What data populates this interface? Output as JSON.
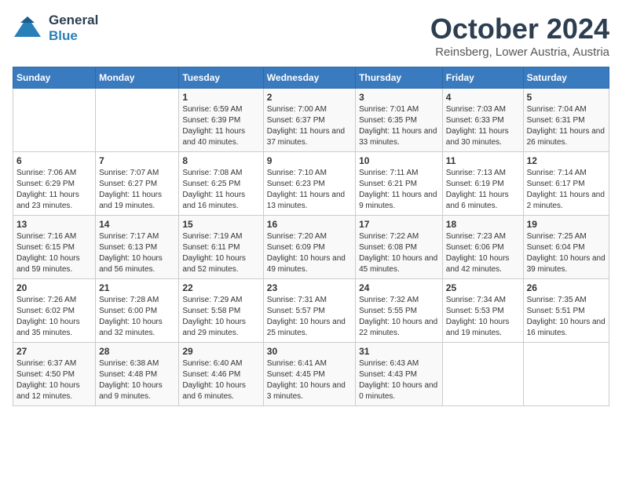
{
  "logo": {
    "line1": "General",
    "line2": "Blue"
  },
  "title": "October 2024",
  "subtitle": "Reinsberg, Lower Austria, Austria",
  "days_of_week": [
    "Sunday",
    "Monday",
    "Tuesday",
    "Wednesday",
    "Thursday",
    "Friday",
    "Saturday"
  ],
  "weeks": [
    [
      {
        "day": "",
        "detail": ""
      },
      {
        "day": "",
        "detail": ""
      },
      {
        "day": "1",
        "detail": "Sunrise: 6:59 AM\nSunset: 6:39 PM\nDaylight: 11 hours and 40 minutes."
      },
      {
        "day": "2",
        "detail": "Sunrise: 7:00 AM\nSunset: 6:37 PM\nDaylight: 11 hours and 37 minutes."
      },
      {
        "day": "3",
        "detail": "Sunrise: 7:01 AM\nSunset: 6:35 PM\nDaylight: 11 hours and 33 minutes."
      },
      {
        "day": "4",
        "detail": "Sunrise: 7:03 AM\nSunset: 6:33 PM\nDaylight: 11 hours and 30 minutes."
      },
      {
        "day": "5",
        "detail": "Sunrise: 7:04 AM\nSunset: 6:31 PM\nDaylight: 11 hours and 26 minutes."
      }
    ],
    [
      {
        "day": "6",
        "detail": "Sunrise: 7:06 AM\nSunset: 6:29 PM\nDaylight: 11 hours and 23 minutes."
      },
      {
        "day": "7",
        "detail": "Sunrise: 7:07 AM\nSunset: 6:27 PM\nDaylight: 11 hours and 19 minutes."
      },
      {
        "day": "8",
        "detail": "Sunrise: 7:08 AM\nSunset: 6:25 PM\nDaylight: 11 hours and 16 minutes."
      },
      {
        "day": "9",
        "detail": "Sunrise: 7:10 AM\nSunset: 6:23 PM\nDaylight: 11 hours and 13 minutes."
      },
      {
        "day": "10",
        "detail": "Sunrise: 7:11 AM\nSunset: 6:21 PM\nDaylight: 11 hours and 9 minutes."
      },
      {
        "day": "11",
        "detail": "Sunrise: 7:13 AM\nSunset: 6:19 PM\nDaylight: 11 hours and 6 minutes."
      },
      {
        "day": "12",
        "detail": "Sunrise: 7:14 AM\nSunset: 6:17 PM\nDaylight: 11 hours and 2 minutes."
      }
    ],
    [
      {
        "day": "13",
        "detail": "Sunrise: 7:16 AM\nSunset: 6:15 PM\nDaylight: 10 hours and 59 minutes."
      },
      {
        "day": "14",
        "detail": "Sunrise: 7:17 AM\nSunset: 6:13 PM\nDaylight: 10 hours and 56 minutes."
      },
      {
        "day": "15",
        "detail": "Sunrise: 7:19 AM\nSunset: 6:11 PM\nDaylight: 10 hours and 52 minutes."
      },
      {
        "day": "16",
        "detail": "Sunrise: 7:20 AM\nSunset: 6:09 PM\nDaylight: 10 hours and 49 minutes."
      },
      {
        "day": "17",
        "detail": "Sunrise: 7:22 AM\nSunset: 6:08 PM\nDaylight: 10 hours and 45 minutes."
      },
      {
        "day": "18",
        "detail": "Sunrise: 7:23 AM\nSunset: 6:06 PM\nDaylight: 10 hours and 42 minutes."
      },
      {
        "day": "19",
        "detail": "Sunrise: 7:25 AM\nSunset: 6:04 PM\nDaylight: 10 hours and 39 minutes."
      }
    ],
    [
      {
        "day": "20",
        "detail": "Sunrise: 7:26 AM\nSunset: 6:02 PM\nDaylight: 10 hours and 35 minutes."
      },
      {
        "day": "21",
        "detail": "Sunrise: 7:28 AM\nSunset: 6:00 PM\nDaylight: 10 hours and 32 minutes."
      },
      {
        "day": "22",
        "detail": "Sunrise: 7:29 AM\nSunset: 5:58 PM\nDaylight: 10 hours and 29 minutes."
      },
      {
        "day": "23",
        "detail": "Sunrise: 7:31 AM\nSunset: 5:57 PM\nDaylight: 10 hours and 25 minutes."
      },
      {
        "day": "24",
        "detail": "Sunrise: 7:32 AM\nSunset: 5:55 PM\nDaylight: 10 hours and 22 minutes."
      },
      {
        "day": "25",
        "detail": "Sunrise: 7:34 AM\nSunset: 5:53 PM\nDaylight: 10 hours and 19 minutes."
      },
      {
        "day": "26",
        "detail": "Sunrise: 7:35 AM\nSunset: 5:51 PM\nDaylight: 10 hours and 16 minutes."
      }
    ],
    [
      {
        "day": "27",
        "detail": "Sunrise: 6:37 AM\nSunset: 4:50 PM\nDaylight: 10 hours and 12 minutes."
      },
      {
        "day": "28",
        "detail": "Sunrise: 6:38 AM\nSunset: 4:48 PM\nDaylight: 10 hours and 9 minutes."
      },
      {
        "day": "29",
        "detail": "Sunrise: 6:40 AM\nSunset: 4:46 PM\nDaylight: 10 hours and 6 minutes."
      },
      {
        "day": "30",
        "detail": "Sunrise: 6:41 AM\nSunset: 4:45 PM\nDaylight: 10 hours and 3 minutes."
      },
      {
        "day": "31",
        "detail": "Sunrise: 6:43 AM\nSunset: 4:43 PM\nDaylight: 10 hours and 0 minutes."
      },
      {
        "day": "",
        "detail": ""
      },
      {
        "day": "",
        "detail": ""
      }
    ]
  ]
}
